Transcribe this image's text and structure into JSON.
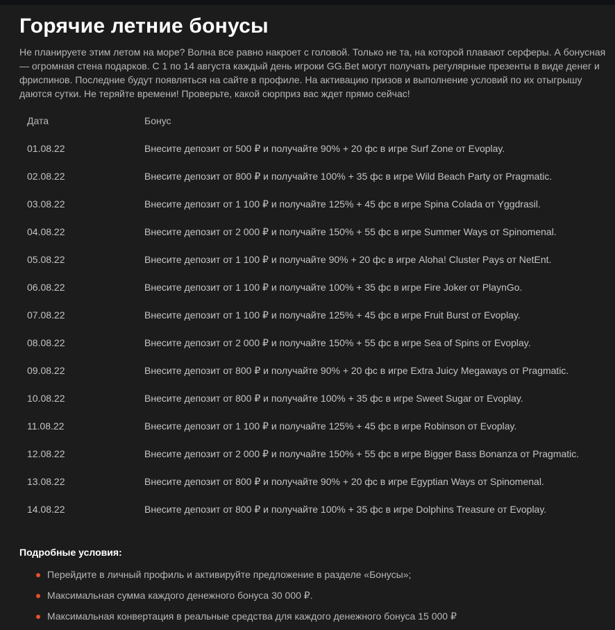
{
  "colors": {
    "background": "#1c1c1c",
    "title": "#ffffff",
    "text": "#b7b7b7",
    "bullet": "#e5502a"
  },
  "page": {
    "title": "Горячие летние бонусы",
    "intro": "Не планируете этим летом на море? Волна все равно накроет с головой. Только не та, на которой плавают серферы. А бонусная — огромная стена подарков. С 1 по 14 августа каждый день игроки GG.Bet могут получать регулярные презенты в виде денег и фриспинов. Последние будут появляться на сайте в профиле. На активацию призов и выполнение условий по их отыгрышу даются сутки. Не теряйте времени! Проверьте, какой сюрприз вас ждет прямо сейчас!"
  },
  "table": {
    "headers": {
      "date": "Дата",
      "bonus": "Бонус"
    },
    "rows": [
      {
        "date": "01.08.22",
        "bonus": "Внесите депозит от 500 ₽ и получайте 90% + 20 фс в игре Surf Zone от Evoplay."
      },
      {
        "date": "02.08.22",
        "bonus": "Внесите депозит от 800 ₽ и получайте 100% + 35 фс в игре Wild Beach Party от Pragmatic."
      },
      {
        "date": "03.08.22",
        "bonus": "Внесите депозит от 1 100 ₽ и получайте 125% + 45 фс в игре Spina Colada от Yggdrasil."
      },
      {
        "date": "04.08.22",
        "bonus": "Внесите депозит от 2 000 ₽ и получайте 150% + 55 фс в игре Summer Ways от Spinomenal."
      },
      {
        "date": "05.08.22",
        "bonus": "Внесите депозит от 1 100 ₽ и получайте 90% + 20 фс в игре Aloha! Cluster Pays от NetEnt."
      },
      {
        "date": "06.08.22",
        "bonus": "Внесите депозит от 1 100 ₽ и получайте 100% + 35 фс в игре Fire Joker от PlaynGo."
      },
      {
        "date": "07.08.22",
        "bonus": "Внесите депозит от 1 100 ₽ и получайте 125% + 45 фс в игре Fruit Burst от Evoplay."
      },
      {
        "date": "08.08.22",
        "bonus": "Внесите депозит от 2 000 ₽ и получайте 150% + 55 фс в игре Sea of Spins от Evoplay."
      },
      {
        "date": "09.08.22",
        "bonus": "Внесите депозит от 800 ₽ и получайте 90% + 20 фс в игре Extra Juicy Megaways от Pragmatic."
      },
      {
        "date": "10.08.22",
        "bonus": "Внесите депозит от 800 ₽ и получайте 100% + 35 фс в игре Sweet Sugar от Evoplay."
      },
      {
        "date": "11.08.22",
        "bonus": "Внесите депозит от 1 100 ₽ и получайте 125% + 45 фс в игре Robinson от Evoplay."
      },
      {
        "date": "12.08.22",
        "bonus": "Внесите депозит от 2 000 ₽ и получайте 150% + 55 фс в игре Bigger Bass Bonanza от Pragmatic."
      },
      {
        "date": "13.08.22",
        "bonus": "Внесите депозит от 800 ₽ и получайте 90% + 20 фс в игре Egyptian Ways от Spinomenal."
      },
      {
        "date": "14.08.22",
        "bonus": "Внесите депозит от 800 ₽ и получайте 100% + 35 фс в игре Dolphins Treasure от Evoplay."
      }
    ]
  },
  "conditions": {
    "title": "Подробные условия:",
    "items": [
      "Перейдите в личный профиль и активируйте предложение в разделе «Бонусы»;",
      "Максимальная сумма каждого денежного бонуса 30 000 ₽.",
      "Максимальная конвертация в реальные средства для каждого денежного бонуса 15 000 ₽"
    ]
  }
}
